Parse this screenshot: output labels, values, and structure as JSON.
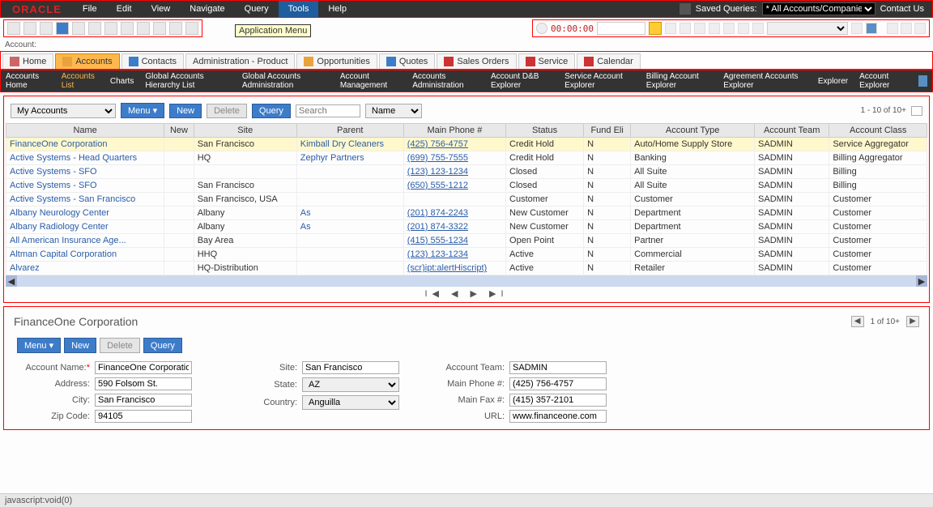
{
  "brand": "ORACLE",
  "menu": [
    "File",
    "Edit",
    "View",
    "Navigate",
    "Query",
    "Tools",
    "Help"
  ],
  "menu_active": 5,
  "tooltip": "Application Menu",
  "saved_queries_label": "Saved Queries:",
  "saved_queries_value": "* All Accounts/Companies",
  "contact_us": "Contact Us",
  "timer": "00:00:00",
  "account_label": "Account:",
  "tabs": [
    {
      "label": "Home",
      "icon": "home-icon",
      "color": "#c66",
      "active": false
    },
    {
      "label": "Accounts",
      "icon": "folder-icon",
      "color": "#e8a33d",
      "active": true
    },
    {
      "label": "Contacts",
      "icon": "person-icon",
      "color": "#3d7cc9",
      "active": false
    },
    {
      "label": "Administration - Product",
      "icon": "",
      "color": "",
      "active": false
    },
    {
      "label": "Opportunities",
      "icon": "opportunity-icon",
      "color": "#e8a33d",
      "active": false
    },
    {
      "label": "Quotes",
      "icon": "quote-icon",
      "color": "#3d7cc9",
      "active": false
    },
    {
      "label": "Sales Orders",
      "icon": "cart-icon",
      "color": "#cc3333",
      "active": false
    },
    {
      "label": "Service",
      "icon": "toolbox-icon",
      "color": "#cc3333",
      "active": false
    },
    {
      "label": "Calendar",
      "icon": "calendar-icon",
      "color": "#cc3333",
      "active": false
    }
  ],
  "subnav": [
    "Accounts Home",
    "Accounts List",
    "Charts",
    "Global Accounts Hierarchy List",
    "Global Accounts Administration",
    "Account Management",
    "Accounts Administration",
    "Account D&B Explorer",
    "Service Account Explorer",
    "Billing Account Explorer",
    "Agreement Accounts Explorer",
    "Explorer",
    "Account Explorer"
  ],
  "subnav_active": 1,
  "list": {
    "view": "My Accounts",
    "menu_btn": "Menu ▾",
    "new_btn": "New",
    "delete_btn": "Delete",
    "query_btn": "Query",
    "search_placeholder": "Search",
    "search_field": "Name",
    "count": "1 - 10 of 10+"
  },
  "columns": [
    "Name",
    "New",
    "Site",
    "Parent",
    "Main Phone #",
    "Status",
    "Fund Eli",
    "Account Type",
    "Account Team",
    "Account Class"
  ],
  "rows": [
    {
      "name": "FinanceOne Corporation",
      "new": "",
      "site": "San Francisco",
      "parent": "Kimball Dry Cleaners",
      "phone": "(425) 756-4757",
      "status": "Credit Hold",
      "fund": "N",
      "type": "Auto/Home Supply Store",
      "team": "SADMIN",
      "cls": "Service Aggregator",
      "sel": true
    },
    {
      "name": "Active Systems - Head Quarters",
      "new": "",
      "site": "HQ",
      "parent": "Zephyr Partners",
      "phone": "(699) 755-7555",
      "status": "Credit Hold",
      "fund": "N",
      "type": "Banking",
      "team": "SADMIN",
      "cls": "Billing Aggregator"
    },
    {
      "name": "Active Systems - SFO",
      "new": "",
      "site": "",
      "parent": "",
      "phone": "(123) 123-1234",
      "status": "Closed",
      "fund": "N",
      "type": "All Suite",
      "team": "SADMIN",
      "cls": "Billing"
    },
    {
      "name": "Active Systems - SFO",
      "new": "",
      "site": "San Francisco",
      "parent": "",
      "phone": "(650) 555-1212",
      "status": "Closed",
      "fund": "N",
      "type": "All Suite",
      "team": "SADMIN",
      "cls": "Billing"
    },
    {
      "name": "Active Systems - San Francisco",
      "new": "",
      "site": "San Francisco, USA",
      "parent": "",
      "phone": "",
      "status": "Customer",
      "fund": "N",
      "type": "Customer",
      "team": "SADMIN",
      "cls": "Customer"
    },
    {
      "name": "Albany Neurology Center",
      "new": "",
      "site": "Albany",
      "parent": "As",
      "phone": "(201) 874-2243",
      "status": "New Customer",
      "fund": "N",
      "type": "Department",
      "team": "SADMIN",
      "cls": "Customer"
    },
    {
      "name": "Albany Radiology Center",
      "new": "",
      "site": "Albany",
      "parent": "As",
      "phone": "(201) 874-3322",
      "status": "New Customer",
      "fund": "N",
      "type": "Department",
      "team": "SADMIN",
      "cls": "Customer"
    },
    {
      "name": "All American Insurance Age...",
      "new": "",
      "site": "Bay Area",
      "parent": "",
      "phone": "(415) 555-1234",
      "status": "Open Point",
      "fund": "N",
      "type": "Partner",
      "team": "SADMIN",
      "cls": "Customer"
    },
    {
      "name": "Altman Capital Corporation",
      "new": "",
      "site": "HHQ",
      "parent": "",
      "phone": "(123) 123-1234",
      "status": "Active",
      "fund": "N",
      "type": "Commercial",
      "team": "SADMIN",
      "cls": "Customer"
    },
    {
      "name": "Alvarez",
      "new": "",
      "site": "HQ-Distribution",
      "parent": "",
      "phone": "(scr)ipt:alertHiscript)",
      "status": "Active",
      "fund": "N",
      "type": "Retailer",
      "team": "SADMIN",
      "cls": "Customer"
    }
  ],
  "pager_glyphs": "I◀  ◀   ▶  ▶I",
  "detail": {
    "title": "FinanceOne Corporation",
    "count": "1 of 10+",
    "menu_btn": "Menu ▾",
    "new_btn": "New",
    "delete_btn": "Delete",
    "query_btn": "Query",
    "labels": {
      "account_name": "Account Name:",
      "address": "Address:",
      "city": "City:",
      "zip": "Zip Code:",
      "site": "Site:",
      "state": "State:",
      "country": "Country:",
      "team": "Account Team:",
      "phone": "Main Phone #:",
      "fax": "Main Fax #:",
      "url": "URL:"
    },
    "values": {
      "account_name": "FinanceOne Corporation",
      "address": "590 Folsom St.",
      "city": "San Francisco",
      "zip": "94105",
      "site": "San Francisco",
      "state": "AZ",
      "country": "Anguilla",
      "team": "SADMIN",
      "phone": "(425) 756-4757",
      "fax": "(415) 357-2101",
      "url": "www.financeone.com"
    }
  },
  "status_text": "javascript:void(0)"
}
